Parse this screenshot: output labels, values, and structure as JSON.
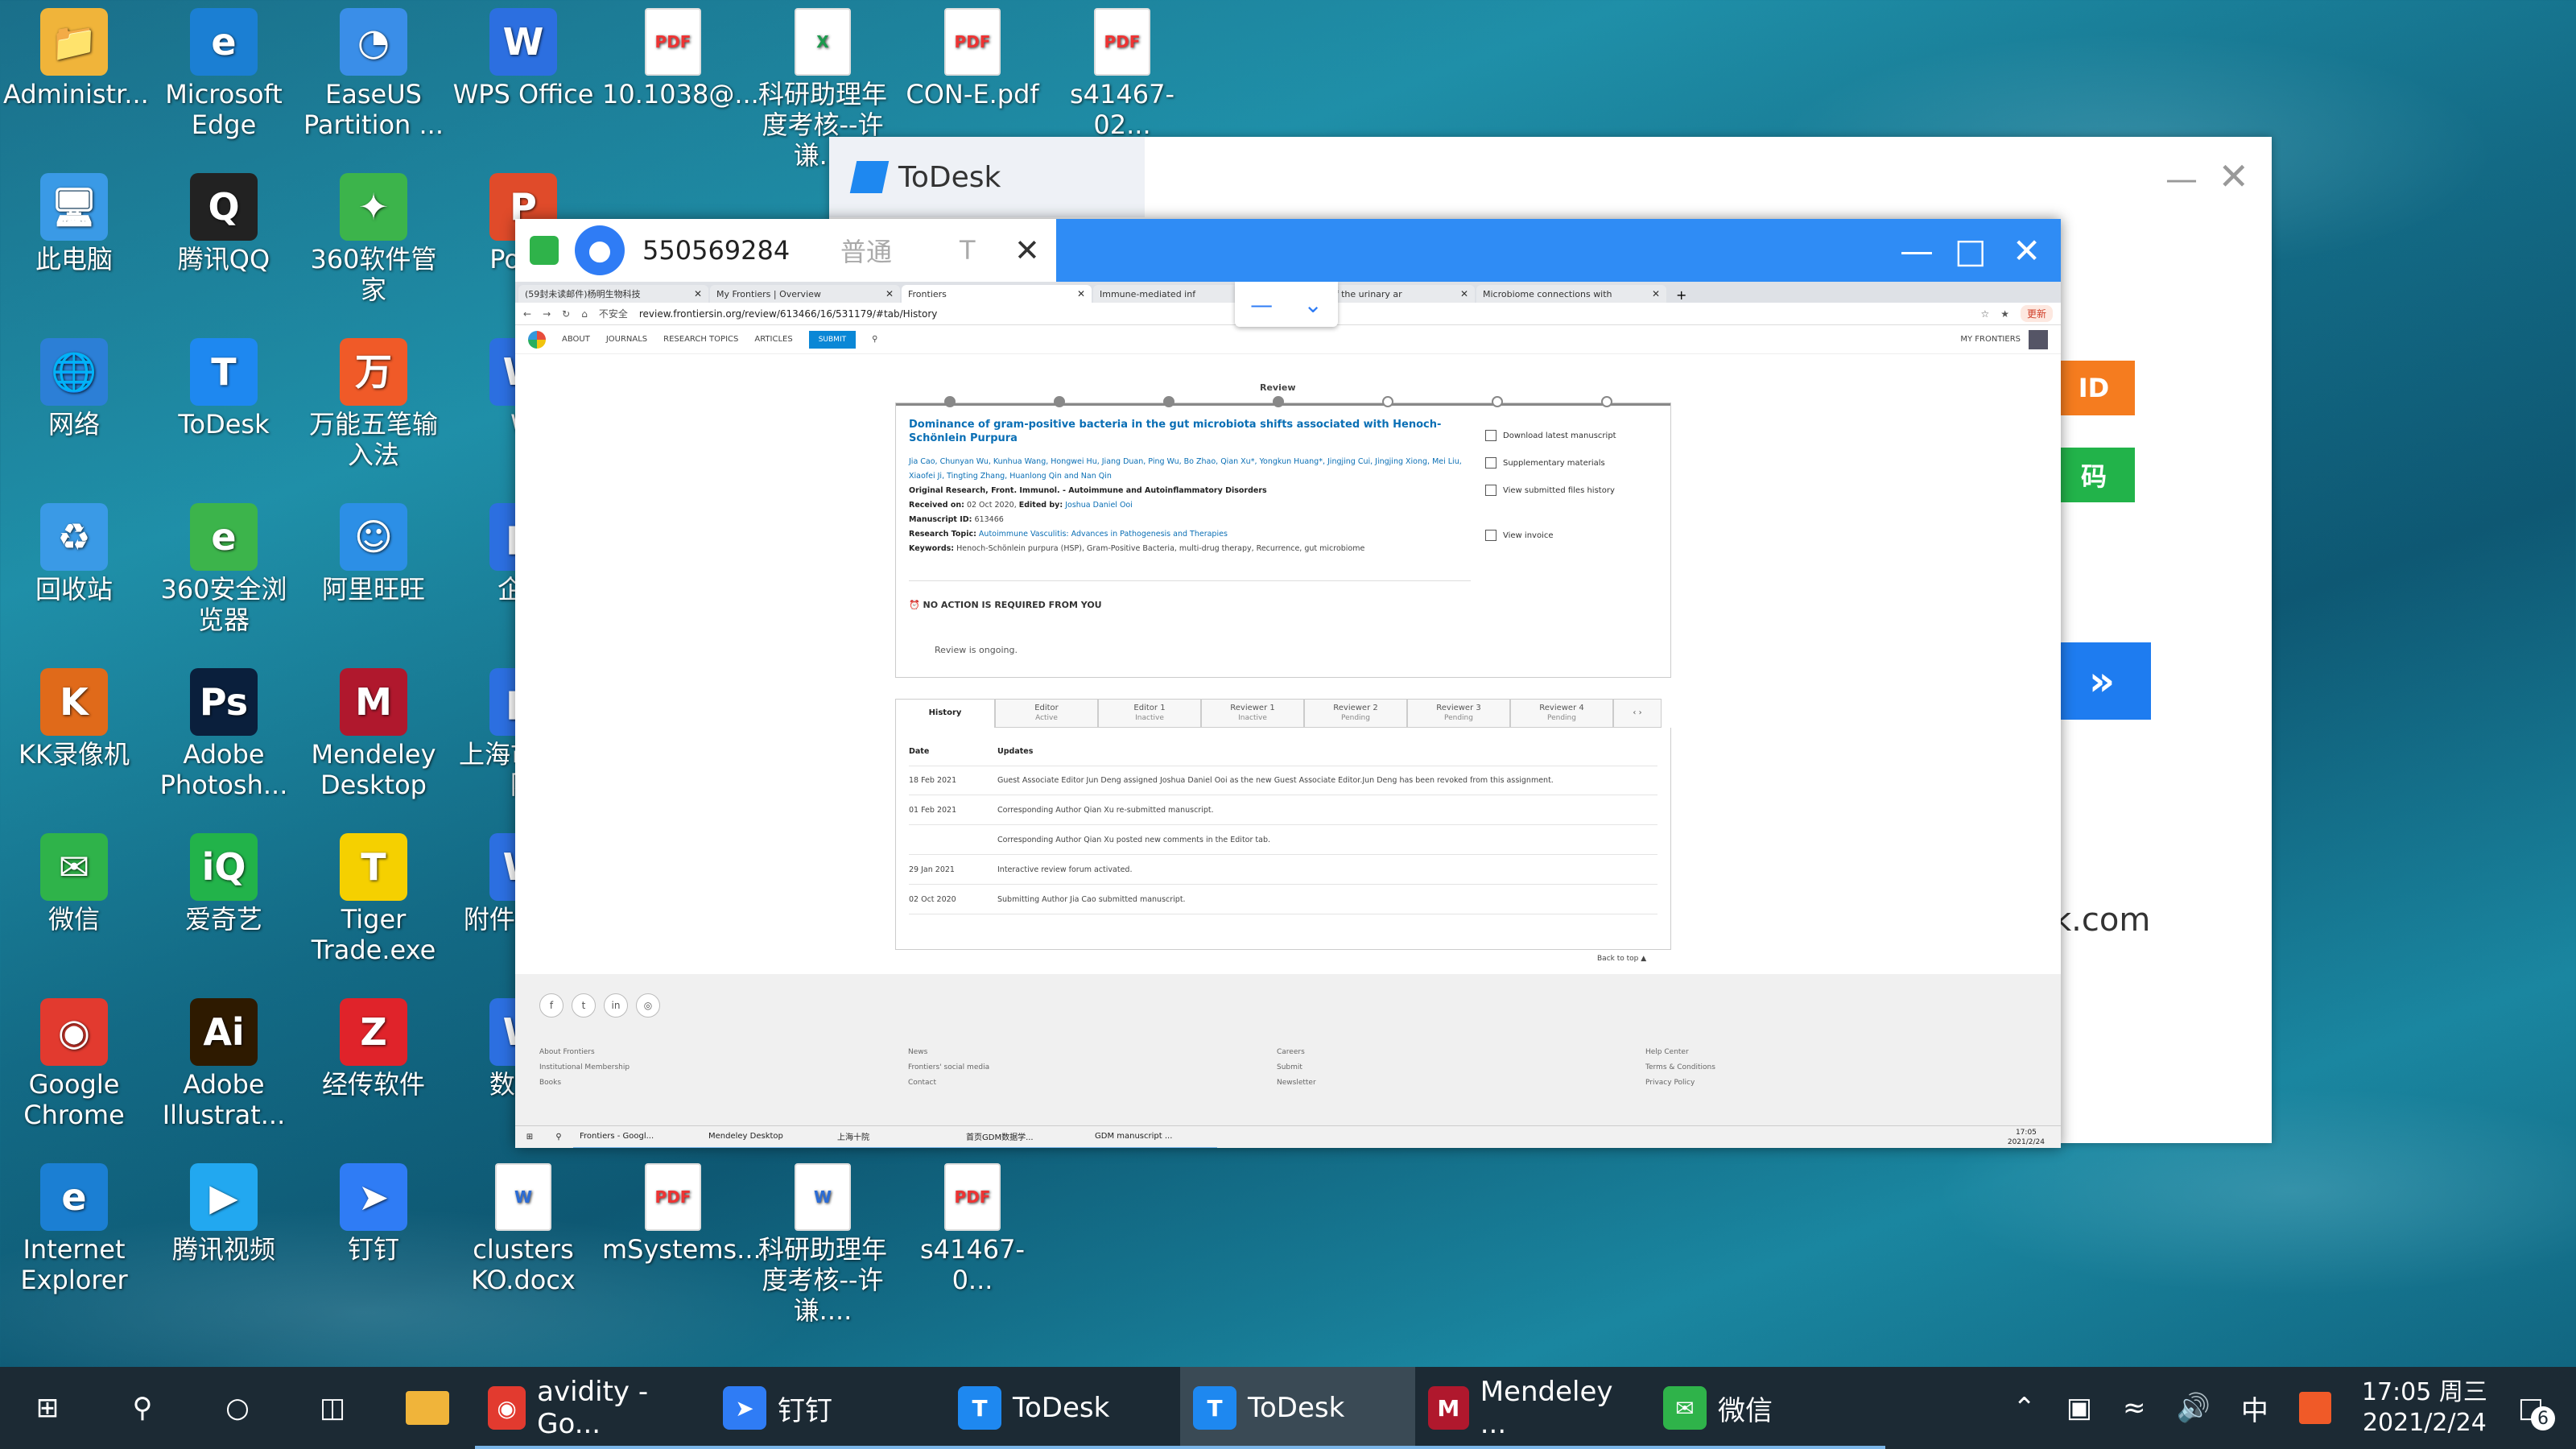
{
  "desktop_icons": [
    {
      "label": "Administr...",
      "glyph": "📁",
      "color": "#f0b43a"
    },
    {
      "label": "Microsoft Edge",
      "glyph": "e",
      "color": "#1b7fd3"
    },
    {
      "label": "EaseUS Partition ...",
      "glyph": "◔",
      "color": "#3a8ee8"
    },
    {
      "label": "WPS Office",
      "glyph": "W",
      "color": "#2c6fe0"
    },
    {
      "label": "10.1038@...",
      "glyph": "PDF",
      "color": "#fff"
    },
    {
      "label": "科研助理年度考核--许谦....",
      "glyph": "X",
      "color": "#fff"
    },
    {
      "label": "CON-E.pdf",
      "glyph": "PDF",
      "color": "#fff"
    },
    {
      "label": "s41467-02...",
      "glyph": "PDF",
      "color": "#fff"
    },
    {
      "label": "此电脑",
      "glyph": "🖥",
      "color": "#3a9ae6"
    },
    {
      "label": "腾讯QQ",
      "glyph": "Q",
      "color": "#222"
    },
    {
      "label": "360软件管家",
      "glyph": "✦",
      "color": "#3cb44b"
    },
    {
      "label": "Powe",
      "glyph": "P",
      "color": "#e04b2a"
    },
    {
      "label": "网络",
      "glyph": "🌐",
      "color": "#2c7fd6"
    },
    {
      "label": "ToDesk",
      "glyph": "T",
      "color": "#1e88f0"
    },
    {
      "label": "万能五笔输入法",
      "glyph": "万",
      "color": "#f05a28"
    },
    {
      "label": "W",
      "glyph": "W",
      "color": "#2c6fe0"
    },
    {
      "label": "回收站",
      "glyph": "♻",
      "color": "#3a9ae6"
    },
    {
      "label": "360安全浏览器",
      "glyph": "e",
      "color": "#3cb44b"
    },
    {
      "label": "阿里旺旺",
      "glyph": "☺",
      "color": "#2c8fe6"
    },
    {
      "label": "企业",
      "glyph": "■",
      "color": "#2c6fe0"
    },
    {
      "label": "KK录像机",
      "glyph": "K",
      "color": "#e06a1a"
    },
    {
      "label": "Adobe Photosh...",
      "glyph": "Ps",
      "color": "#0a1f3c"
    },
    {
      "label": "Mendeley Desktop",
      "glyph": "M",
      "color": "#b0182d"
    },
    {
      "label": "上海市民医院",
      "glyph": "■",
      "color": "#2c6fe0"
    },
    {
      "label": "微信",
      "glyph": "✉",
      "color": "#2fb34a"
    },
    {
      "label": "爱奇艺",
      "glyph": "iQ",
      "color": "#22b34a"
    },
    {
      "label": "Tiger Trade.exe",
      "glyph": "T",
      "color": "#f5d000"
    },
    {
      "label": "附件3申请",
      "glyph": "W",
      "color": "#2c6fe0"
    },
    {
      "label": "Google Chrome",
      "glyph": "◉",
      "color": "#e23a2f"
    },
    {
      "label": "Adobe Illustrat...",
      "glyph": "Ai",
      "color": "#2e1a00"
    },
    {
      "label": "经传软件",
      "glyph": "Z",
      "color": "#e0232a"
    },
    {
      "label": "数学d",
      "glyph": "W",
      "color": "#2c6fe0"
    },
    {
      "label": "Internet Explorer",
      "glyph": "e",
      "color": "#1b7fd3"
    },
    {
      "label": "腾讯视频",
      "glyph": "▶",
      "color": "#22a8f0"
    },
    {
      "label": "钉钉",
      "glyph": "➤",
      "color": "#2f7cf5"
    },
    {
      "label": "clusters KO.docx",
      "glyph": "W",
      "color": "#fff"
    },
    {
      "label": "mSystems....",
      "glyph": "PDF",
      "color": "#fff"
    },
    {
      "label": "科研助理年度考核--许谦....",
      "glyph": "W",
      "color": "#fff"
    },
    {
      "label": "s41467-0...",
      "glyph": "PDF",
      "color": "#fff"
    }
  ],
  "todesk_bg": {
    "title": "ToDesk",
    "minimize": "—",
    "close": "✕",
    "badge1": "ID",
    "badge2": "码",
    "badge3": "»",
    "url_fragment": "k.com"
  },
  "remote": {
    "session_id": "550569284",
    "mode": "普通",
    "t_btn": "T",
    "x_btn": "✕",
    "win_min": "—",
    "win_max": "□",
    "win_close": "✕"
  },
  "browser": {
    "tabs": [
      {
        "label": "(59封未读邮件)杨明生物科技"
      },
      {
        "label": "My Frontiers | Overview"
      },
      {
        "label": "Frontiers",
        "active": true
      },
      {
        "label": "Immune-mediated inf"
      },
      {
        "label": "minants of the urinary ar"
      },
      {
        "label": "Microbiome connections with"
      }
    ],
    "insecure": "不安全",
    "url": "review.frontiersin.org/review/613466/16/531179/#tab/History",
    "update_btn": "更新"
  },
  "frontiers_nav": {
    "items": [
      "ABOUT",
      "JOURNALS",
      "RESEARCH TOPICS",
      "ARTICLES"
    ],
    "submit": "SUBMIT",
    "my_frontiers": "MY FRONTIERS"
  },
  "review": {
    "stage_label": "Review",
    "title": "Dominance of gram-positive bacteria in the gut microbiota shifts associated with Henoch-Schönlein Purpura",
    "authors": "Jia Cao, Chunyan Wu, Kunhua Wang, Hongwei Hu, Jiang Duan, Ping Wu, Bo Zhao, Qian Xu*, Yongkun Huang*, Jingjing Cui, Jingjing Xiong, Mei Liu, Xiaofei Ji, Tingting Zhang, Huanlong Qin and Nan Qin",
    "type_line": "Original Research, Front. Immunol. - Autoimmune and Autoinflammatory Disorders",
    "received_label": "Received on:",
    "received": "02 Oct 2020",
    "edited_label": "Edited by:",
    "editor": "Joshua Daniel Ooi",
    "msid_label": "Manuscript ID:",
    "msid": "613466",
    "topic_label": "Research Topic:",
    "topic": "Autoimmune Vasculitis: Advances in Pathogenesis and Therapies",
    "keywords_label": "Keywords:",
    "keywords": "Henoch-Schönlein purpura (HSP), Gram-Positive Bacteria, multi-drug therapy, Recurrence, gut microbiome",
    "side": [
      "Download latest manuscript",
      "Supplementary materials",
      "View submitted files history",
      "View invoice"
    ],
    "no_action": "NO ACTION IS REQUIRED FROM YOU",
    "ongoing": "Review is ongoing."
  },
  "history_tabs": [
    {
      "label": "History",
      "sub": ""
    },
    {
      "label": "Editor",
      "sub": "Active"
    },
    {
      "label": "Editor 1",
      "sub": "Inactive"
    },
    {
      "label": "Reviewer 1",
      "sub": "Inactive"
    },
    {
      "label": "Reviewer 2",
      "sub": "Pending"
    },
    {
      "label": "Reviewer 3",
      "sub": "Pending"
    },
    {
      "label": "Reviewer 4",
      "sub": "Pending"
    }
  ],
  "history": {
    "head_date": "Date",
    "head_updates": "Updates",
    "rows": [
      {
        "date": "18 Feb 2021",
        "update": "Guest Associate Editor Jun Deng assigned Joshua Daniel Ooi as the new Guest Associate Editor.Jun Deng has been revoked from this assignment."
      },
      {
        "date": "01 Feb 2021",
        "update": "Corresponding Author Qian Xu re-submitted manuscript."
      },
      {
        "date": "",
        "update": "Corresponding Author Qian Xu posted new comments in the Editor tab."
      },
      {
        "date": "29 Jan 2021",
        "update": "Interactive review forum activated."
      },
      {
        "date": "02 Oct 2020",
        "update": "Submitting Author Jia Cao submitted manuscript."
      }
    ],
    "back_to_top": "Back to top"
  },
  "footer": {
    "social": [
      "f",
      "t",
      "in",
      "◎"
    ],
    "col1": [
      "About Frontiers",
      "Institutional Membership",
      "Books"
    ],
    "col2": [
      "News",
      "Frontiers' social media",
      "Contact"
    ],
    "col3": [
      "Careers",
      "Submit",
      "Newsletter"
    ],
    "col4": [
      "Help Center",
      "Terms & Conditions",
      "Privacy Policy"
    ]
  },
  "remote_taskbar": {
    "apps": [
      "Frontiers - Googl...",
      "Mendeley Desktop",
      "上海十院",
      "首页GDM数据学...",
      "GDM manuscript ..."
    ],
    "time": "17:05",
    "date": "2021/2/24"
  },
  "taskbar": {
    "apps": [
      {
        "label": "avidity - Go...",
        "color": "#e23a2f",
        "glyph": "◉"
      },
      {
        "label": "钉钉",
        "color": "#2f7cf5",
        "glyph": "➤"
      },
      {
        "label": "ToDesk",
        "color": "#1e88f0",
        "glyph": "T"
      },
      {
        "label": "ToDesk",
        "color": "#1e88f0",
        "glyph": "T",
        "active": true
      },
      {
        "label": "Mendeley ...",
        "color": "#b0182d",
        "glyph": "M"
      },
      {
        "label": "微信",
        "color": "#2fb34a",
        "glyph": "✉"
      }
    ],
    "ime": "中",
    "time": "17:05 周三",
    "date": "2021/2/24",
    "notif_count": "6"
  }
}
